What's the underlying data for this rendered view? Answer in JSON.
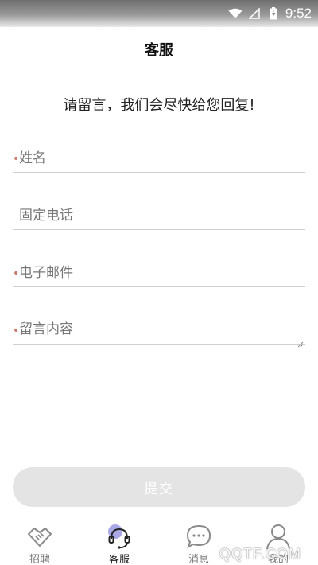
{
  "status_bar": {
    "time": "9:52",
    "icons": [
      "wifi-icon",
      "signal-icon",
      "battery-charging-icon"
    ]
  },
  "header": {
    "title": "客服"
  },
  "form": {
    "intro": "请留言，我们会尽快给您回复!",
    "required_mark": "•",
    "fields": [
      {
        "placeholder": "姓名",
        "value": "",
        "required": true
      },
      {
        "placeholder": "固定电话",
        "value": "",
        "required": false
      },
      {
        "placeholder": "电子邮件",
        "value": "",
        "required": true
      },
      {
        "placeholder": "留言内容",
        "value": "",
        "required": true
      }
    ],
    "submit_label": "提交"
  },
  "bottom_nav": {
    "items": [
      {
        "label": "招聘",
        "icon": "handshake-icon",
        "active": false
      },
      {
        "label": "客服",
        "icon": "headset-icon",
        "active": true
      },
      {
        "label": "消息",
        "icon": "chat-bubble-icon",
        "active": false
      },
      {
        "label": "我的",
        "icon": "person-icon",
        "active": false
      }
    ]
  },
  "watermark": "QQTF.COM",
  "colors": {
    "required_mark": "#c77b6b",
    "active_dot": "#a9a7e6",
    "submit_bg": "#e4e4e4"
  }
}
